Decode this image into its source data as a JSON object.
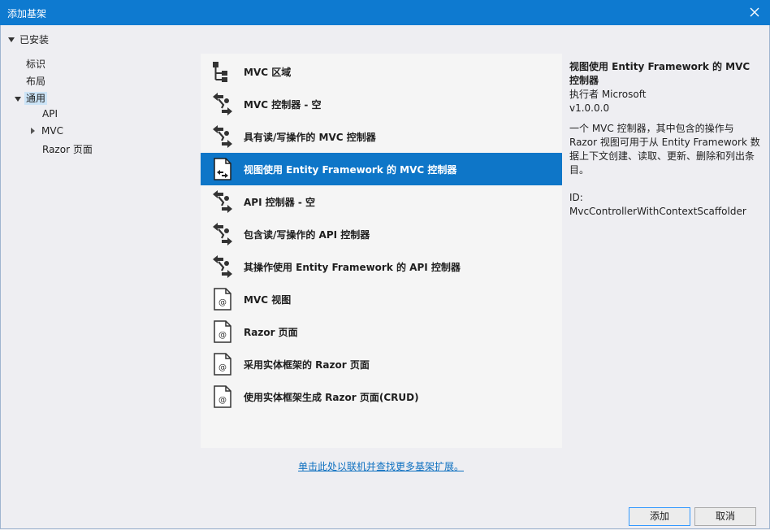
{
  "window": {
    "title": "添加基架"
  },
  "installed_label": "已安装",
  "tree": {
    "item0": "标识",
    "item1": "布局",
    "item2": "通用",
    "item2_children": [
      "API",
      "MVC",
      "Razor 页面"
    ]
  },
  "templates": [
    {
      "name": "MVC 区域",
      "icon": "area-icon"
    },
    {
      "name": "MVC 控制器 - 空",
      "icon": "controller-icon"
    },
    {
      "name": "具有读/写操作的 MVC 控制器",
      "icon": "controller-icon"
    },
    {
      "name": "视图使用 Entity Framework 的 MVC 控制器",
      "icon": "controller-view-icon",
      "selected": true
    },
    {
      "name": "API 控制器 - 空",
      "icon": "controller-icon"
    },
    {
      "name": "包含读/写操作的 API 控制器",
      "icon": "controller-icon"
    },
    {
      "name": "其操作使用 Entity Framework 的 API 控制器",
      "icon": "controller-icon"
    },
    {
      "name": "MVC 视图",
      "icon": "razor-page-icon"
    },
    {
      "name": "Razor 页面",
      "icon": "razor-page-icon"
    },
    {
      "name": "采用实体框架的 Razor 页面",
      "icon": "razor-page-icon"
    },
    {
      "name": "使用实体框架生成 Razor 页面(CRUD)",
      "icon": "razor-page-icon"
    }
  ],
  "details": {
    "title": "视图使用 Entity Framework 的 MVC 控制器",
    "author": "执行者 Microsoft",
    "version": "v1.0.0.0",
    "description": "一个 MVC 控制器，其中包含的操作与 Razor 视图可用于从 Entity Framework 数据上下文创建、读取、更新、删除和列出条目。",
    "id": "ID: MvcControllerWithContextScaffolder"
  },
  "online_link": "单击此处以联机并查找更多基架扩展。",
  "buttons": {
    "add": "添加",
    "cancel": "取消"
  },
  "colors": {
    "titlebar": "#0e7ad0",
    "selection": "#0e76c8",
    "link": "#0e70c0"
  }
}
